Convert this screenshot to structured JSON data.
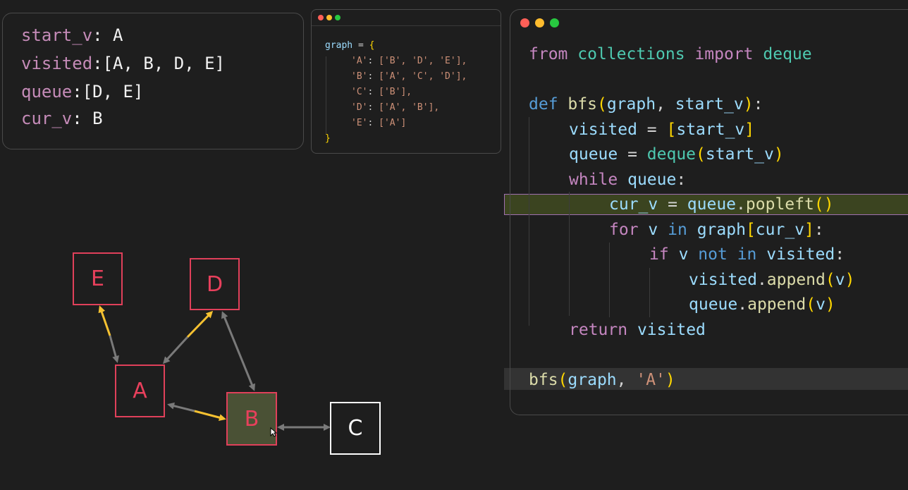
{
  "state": {
    "start_v_key": "start_v",
    "start_v_val": ": A",
    "visited_key": "visited",
    "visited_val": ":[A, B, D, E]",
    "queue_key": "queue",
    "queue_val": ":[D, E]",
    "cur_v_key": "cur_v",
    "cur_v_val": ": B"
  },
  "dict_code": {
    "l1a": "graph",
    "l1b": " = ",
    "l1c": "{",
    "l2k": "'A'",
    "l2v": "['B', 'D', 'E'],",
    "l3k": "'B'",
    "l3v": "['A', 'C', 'D'],",
    "l4k": "'C'",
    "l4v": "['B'],",
    "l5k": "'D'",
    "l5v": "['A', 'B'],",
    "l6k": "'E'",
    "l6v": "['A']",
    "l7": "}",
    "colon": ": "
  },
  "code": {
    "from": "from",
    "collections": "collections",
    "import": "import",
    "deque": "deque",
    "def": "def",
    "bfs": "bfs",
    "graph": "graph",
    "start_v": "start_v",
    "visited": "visited",
    "queue": "queue",
    "while": "while",
    "cur_v": "cur_v",
    "popleft": "popleft",
    "for": "for",
    "v": "v",
    "in": "in",
    "if": "if",
    "not": "not",
    "append": "append",
    "return": "return",
    "str_A": "'A'"
  },
  "graph_nodes": [
    {
      "label": "E",
      "state": "visited"
    },
    {
      "label": "D",
      "state": "visited"
    },
    {
      "label": "A",
      "state": "visited"
    },
    {
      "label": "B",
      "state": "current"
    },
    {
      "label": "C",
      "state": "unvisited"
    }
  ],
  "colors": {
    "visited": "#e0405a",
    "current_fill": "#4a5135",
    "edge_active": "#f5c131",
    "edge_inactive": "#7a7a7a",
    "line_highlight": "#3b4420"
  }
}
